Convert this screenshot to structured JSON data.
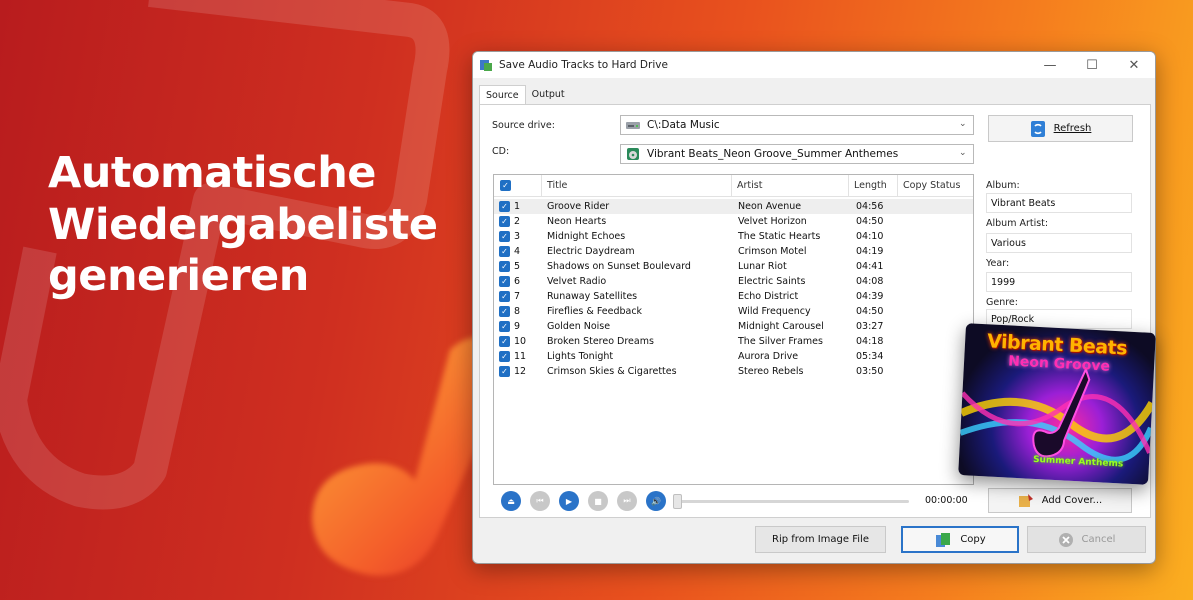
{
  "headline": [
    "Automatische",
    "Wiedergabeliste",
    "generieren"
  ],
  "window": {
    "title": "Save Audio Tracks to Hard Drive",
    "controls": {
      "minimize": "—",
      "maximize": "☐",
      "close": "✕"
    }
  },
  "tabs": [
    {
      "label": "Source",
      "active": true
    },
    {
      "label": "Output",
      "active": false
    }
  ],
  "source": {
    "drive_label": "Source drive:",
    "drive_value": "C\\:Data Music",
    "cd_label": "CD:",
    "cd_value": "Vibrant Beats_Neon Groove_Summer Anthemes",
    "refresh_label": "Refresh"
  },
  "table": {
    "columns": [
      "Title",
      "Artist",
      "Length",
      "Copy Status"
    ],
    "rows": [
      {
        "num": "1",
        "title": "Groove Rider",
        "artist": "Neon Avenue",
        "length": "04:56"
      },
      {
        "num": "2",
        "title": "Neon Hearts",
        "artist": "Velvet Horizon",
        "length": "04:50"
      },
      {
        "num": "3",
        "title": "Midnight Echoes",
        "artist": "The Static Hearts",
        "length": "04:10"
      },
      {
        "num": "4",
        "title": "Electric Daydream",
        "artist": "Crimson Motel",
        "length": "04:19"
      },
      {
        "num": "5",
        "title": "Shadows on Sunset Boulevard",
        "artist": "Lunar Riot",
        "length": "04:41"
      },
      {
        "num": "6",
        "title": "Velvet Radio",
        "artist": "Electric Saints",
        "length": "04:08"
      },
      {
        "num": "7",
        "title": "Runaway Satellites",
        "artist": "Echo District",
        "length": "04:39"
      },
      {
        "num": "8",
        "title": "Fireflies & Feedback",
        "artist": "Wild Frequency",
        "length": "04:50"
      },
      {
        "num": "9",
        "title": "Golden Noise",
        "artist": "Midnight Carousel",
        "length": "03:27"
      },
      {
        "num": "10",
        "title": "Broken Stereo Dreams",
        "artist": "The Silver Frames",
        "length": "04:18"
      },
      {
        "num": "11",
        "title": "Lights Tonight",
        "artist": "Aurora Drive",
        "length": "05:34"
      },
      {
        "num": "12",
        "title": "Crimson Skies & Cigarettes",
        "artist": "Stereo Rebels",
        "length": "03:50"
      }
    ]
  },
  "metadata": {
    "album_label": "Album:",
    "album_value": "Vibrant Beats",
    "album_artist_label": "Album Artist:",
    "album_artist_value": "Various",
    "year_label": "Year:",
    "year_value": "1999",
    "genre_label": "Genre:",
    "genre_value": "Pop/Rock"
  },
  "player": {
    "time": "00:00:00",
    "seek_position": 0
  },
  "buttons": {
    "add_cover": "Add Cover...",
    "rip_from_image": "Rip from Image File",
    "copy": "Copy",
    "cancel": "Cancel"
  },
  "cover_art": {
    "line1": "Vibrant Beats",
    "line2": "Neon Groove",
    "line3": "Summer Anthems"
  },
  "colors": {
    "checkbox": "#1f6fc4",
    "accent_blue": "#2a73c8",
    "bg_gradient_start": "#b81c1e",
    "bg_gradient_end": "#fbae20"
  }
}
